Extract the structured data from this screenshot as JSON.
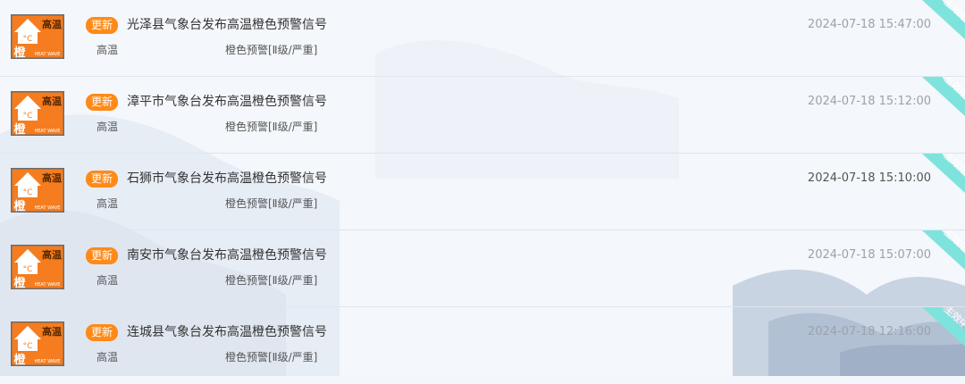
{
  "colors": {
    "badge": "#ff8a17",
    "ribbon": "#7ee3dd",
    "icon_orange": "#f57c1f"
  },
  "icon": {
    "name": "heat-wave-orange-warning-icon",
    "temp": "°C",
    "chars": "高温",
    "level_char": "橙",
    "en": "HEAT WAVE"
  },
  "alerts": [
    {
      "badge": "更新",
      "title": "光泽县气象台发布高温橙色预警信号",
      "category": "高温",
      "level": "橙色预警[Ⅱ级/严重]",
      "time": "2024-07-18 15:47:00",
      "status": "生效中"
    },
    {
      "badge": "更新",
      "title": "漳平市气象台发布高温橙色预警信号",
      "category": "高温",
      "level": "橙色预警[Ⅱ级/严重]",
      "time": "2024-07-18 15:12:00",
      "status": "生效中"
    },
    {
      "badge": "更新",
      "title": "石狮市气象台发布高温橙色预警信号",
      "category": "高温",
      "level": "橙色预警[Ⅱ级/严重]",
      "time": "2024-07-18 15:10:00",
      "status": "生效中"
    },
    {
      "badge": "更新",
      "title": "南安市气象台发布高温橙色预警信号",
      "category": "高温",
      "level": "橙色预警[Ⅱ级/严重]",
      "time": "2024-07-18 15:07:00",
      "status": "生效中"
    },
    {
      "badge": "更新",
      "title": "连城县气象台发布高温橙色预警信号",
      "category": "高温",
      "level": "橙色预警[Ⅱ级/严重]",
      "time": "2024-07-18 12:16:00",
      "status": "生效中"
    }
  ]
}
